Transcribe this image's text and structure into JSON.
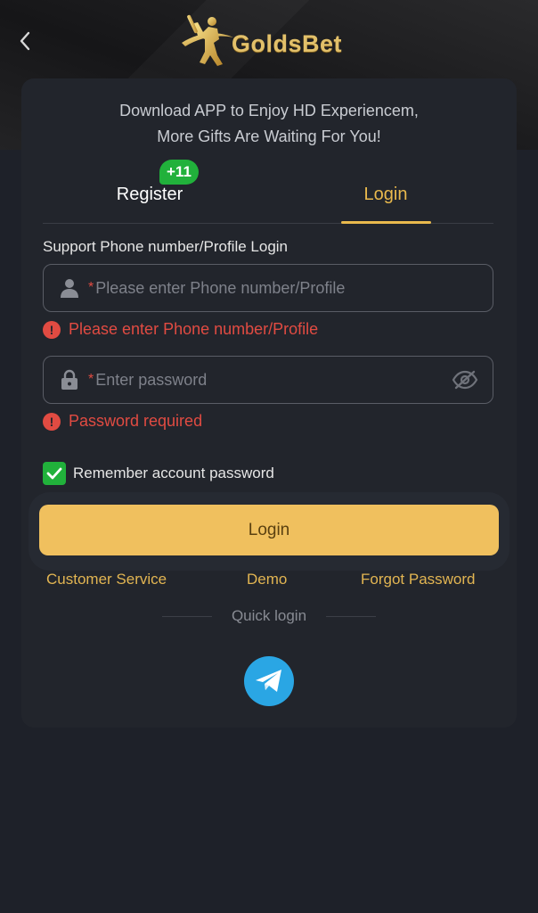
{
  "header": {
    "back_icon": "chevron-left-icon",
    "logo_text": "GoldsBet",
    "logo_icon": "cricket-player-icon"
  },
  "promo": {
    "line1": "Download APP to Enjoy HD Experiencem,",
    "line2": "More Gifts Are Waiting For You!"
  },
  "tabs": {
    "register_label": "Register",
    "register_badge": "+11",
    "login_label": "Login",
    "active": "login"
  },
  "form": {
    "section_label": "Support Phone number/Profile Login",
    "required_mark": "*",
    "phone": {
      "icon": "user-icon",
      "placeholder": "Please enter Phone number/Profile",
      "value": "",
      "error": "Please enter Phone number/Profile"
    },
    "password": {
      "icon": "lock-icon",
      "placeholder": "Enter password",
      "value": "",
      "error": "Password required",
      "visibility_icon": "eye-off-icon"
    },
    "remember": {
      "label": "Remember account password",
      "checked": true
    },
    "submit_label": "Login"
  },
  "links": {
    "customer_service": "Customer Service",
    "demo": "Demo",
    "forgot_password": "Forgot Password"
  },
  "quick_login": {
    "label": "Quick login",
    "providers": [
      "telegram-icon"
    ]
  },
  "colors": {
    "background": "#1e2129",
    "card": "#22252c",
    "accent_gold": "#e9b94d",
    "button": "#f0c05e",
    "error": "#e14b42",
    "success_green": "#21b13b",
    "telegram": "#2aa6e4"
  }
}
